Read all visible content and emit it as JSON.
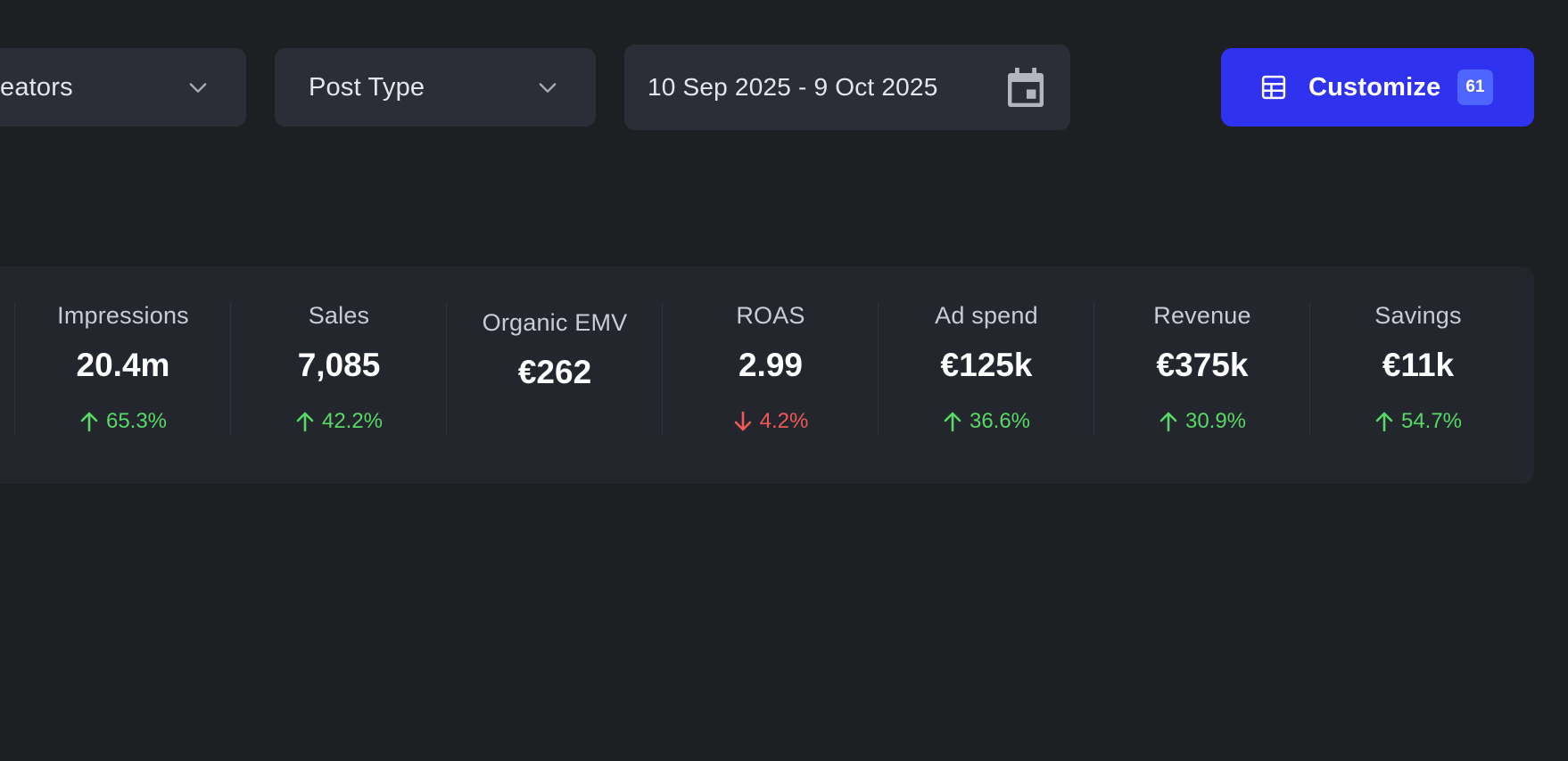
{
  "filters": {
    "creators_label": "eators",
    "post_type_label": "Post Type",
    "date_range_label": "10 Sep 2025 - 9 Oct 2025"
  },
  "customize": {
    "label": "Customize",
    "count": "61"
  },
  "colors": {
    "background": "#1e1f22",
    "panel": "#24262d",
    "control": "#2b2e36",
    "accent": "#2f33f0",
    "badge": "#4e66ff",
    "positive": "#58d866",
    "negative": "#ef5a58"
  },
  "icons": {
    "filter_chevron": "chevron-down-icon",
    "date_picker": "calendar-icon",
    "customize": "table-grid-icon",
    "change_up": "arrow-up-icon",
    "change_down": "arrow-down-icon"
  },
  "metrics": [
    {
      "label": "Impressions",
      "value": "20.4m",
      "change": "65.3%",
      "direction": "up"
    },
    {
      "label": "Sales",
      "value": "7,085",
      "change": "42.2%",
      "direction": "up"
    },
    {
      "label": "Organic EMV",
      "value": "€262",
      "change": null,
      "direction": null
    },
    {
      "label": "ROAS",
      "value": "2.99",
      "change": "4.2%",
      "direction": "down"
    },
    {
      "label": "Ad spend",
      "value": "€125k",
      "change": "36.6%",
      "direction": "up"
    },
    {
      "label": "Revenue",
      "value": "€375k",
      "change": "30.9%",
      "direction": "up"
    },
    {
      "label": "Savings",
      "value": "€11k",
      "change": "54.7%",
      "direction": "up"
    }
  ]
}
